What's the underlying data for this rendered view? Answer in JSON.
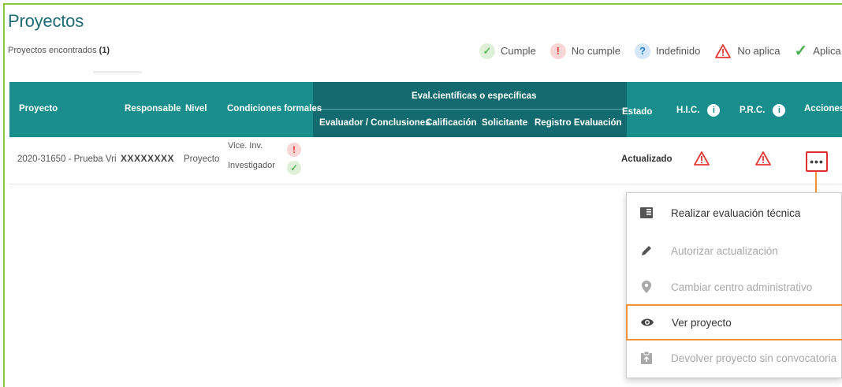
{
  "header": {
    "title": "Proyectos",
    "found_label": "Proyectos encontrados",
    "found_count": "(1)"
  },
  "legend": [
    {
      "label": "Cumple",
      "icon": "check-circle-icon"
    },
    {
      "label": "No cumple",
      "icon": "exclamation-circle-icon"
    },
    {
      "label": "Indefinido",
      "icon": "question-circle-icon"
    },
    {
      "label": "No aplica",
      "icon": "warning-triangle-icon"
    },
    {
      "label": "Aplica",
      "icon": "checkmark-icon"
    }
  ],
  "table": {
    "headers": {
      "proyecto": "Proyecto",
      "responsable": "Responsable",
      "nivel": "Nivel",
      "condiciones": "Condiciones formales",
      "eval_group": "Eval.científicas o específicas",
      "evaluador": "Evaluador / Conclusiones",
      "calificacion": "Calificación",
      "solicitante": "Solicitante",
      "registro": "Registro Evaluación",
      "estado": "Estado",
      "hic": "H.I.C.",
      "prc": "P.R.C.",
      "acciones": "Acciones"
    },
    "rows": [
      {
        "proyecto": "2020-31650 - Prueba Vri",
        "responsable": "XXXXXXXX",
        "nivel": "Proyecto",
        "condiciones": [
          {
            "label": "Vice. Inv.",
            "status": "no-cumple"
          },
          {
            "label": "Investigador",
            "status": "cumple"
          }
        ],
        "estado": "Actualizado",
        "actions_label": "•••"
      }
    ]
  },
  "menu": {
    "items": [
      {
        "label": "Realizar evaluación técnica",
        "icon": "book-icon",
        "enabled": true
      },
      {
        "label": "Autorizar actualización",
        "icon": "pencil-icon",
        "enabled": false
      },
      {
        "label": "Cambiar centro administrativo",
        "icon": "location-pin-icon",
        "enabled": false
      },
      {
        "label": "Ver proyecto",
        "icon": "eye-icon",
        "enabled": true
      },
      {
        "label": "Devolver proyecto sin convocatoria",
        "icon": "clipboard-icon",
        "enabled": false
      }
    ]
  },
  "colors": {
    "accent": "#1a8d8d",
    "accent_dark": "#146b6f",
    "frame_green": "#8cc63f",
    "highlight_orange": "#f39237",
    "alert_red": "#e53935"
  }
}
